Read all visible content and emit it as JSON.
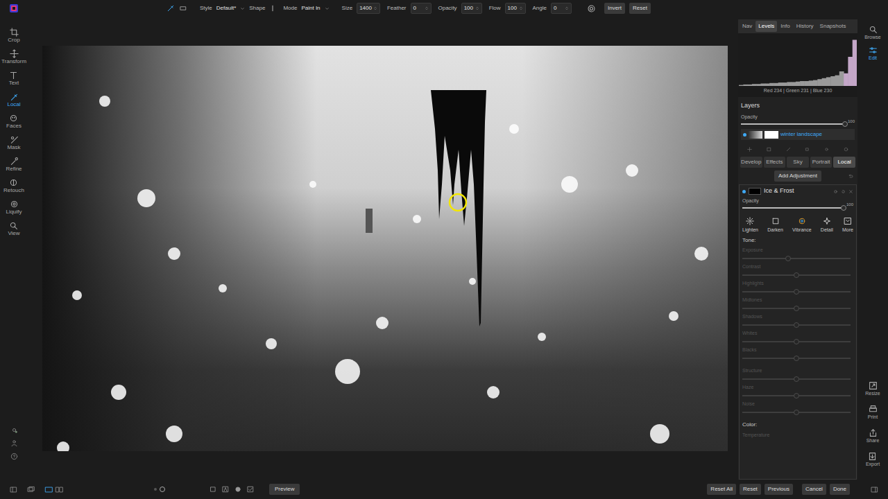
{
  "toolbar": {
    "style_label": "Style",
    "style_value": "Default*",
    "shape_label": "Shape",
    "mode_label": "Mode",
    "mode_value": "Paint In",
    "fields": [
      {
        "label": "Size",
        "value": "1400"
      },
      {
        "label": "Feather",
        "value": "0"
      },
      {
        "label": "Opacity",
        "value": "100"
      },
      {
        "label": "Flow",
        "value": "100"
      },
      {
        "label": "Angle",
        "value": "0"
      }
    ],
    "buttons": [
      "Invert",
      "Reset"
    ]
  },
  "tools": [
    {
      "label": "Crop",
      "selected": false
    },
    {
      "label": "Transform",
      "selected": false
    },
    {
      "label": "Text",
      "selected": false
    },
    {
      "label": "Local",
      "selected": true
    },
    {
      "label": "Faces",
      "selected": false
    },
    {
      "label": "Mask",
      "selected": false
    },
    {
      "label": "Refine",
      "selected": false
    },
    {
      "label": "Retouch",
      "selected": false
    },
    {
      "label": "Liquify",
      "selected": false
    },
    {
      "label": "View",
      "selected": false
    }
  ],
  "panel": {
    "tabs": [
      {
        "label": "Nav",
        "selected": false
      },
      {
        "label": "Levels",
        "selected": true
      },
      {
        "label": "Info",
        "selected": false
      },
      {
        "label": "History",
        "selected": false
      },
      {
        "label": "Snapshots",
        "selected": false
      }
    ],
    "histogram": [
      2,
      3,
      3,
      4,
      4,
      5,
      5,
      6,
      6,
      7,
      7,
      8,
      8,
      9,
      10,
      10,
      11,
      12,
      14,
      16,
      18,
      20,
      22,
      30,
      26,
      60,
      95
    ],
    "histogram_readout": "Red 234 | Green 231 | Blue 230",
    "layers": {
      "title": "Layers",
      "opacity_label": "Opacity",
      "opacity_value": "100",
      "opacity_level": 1,
      "layer_name": "winter landscape",
      "visible": true
    },
    "module_tabs": [
      {
        "label": "Develop",
        "selected": false
      },
      {
        "label": "Effects",
        "selected": false
      },
      {
        "label": "Sky",
        "selected": false
      },
      {
        "label": "Portrait",
        "selected": false
      },
      {
        "label": "Local",
        "selected": true
      }
    ],
    "add_adjustment": "Add Adjustment",
    "adjustment": {
      "name": "Ice & Frost",
      "visible": true,
      "opacity_label": "Opacity",
      "opacity_value": "100",
      "opacity_level": 1,
      "presets": [
        "Lighten",
        "Darken",
        "Vibrance",
        "Detail",
        "More"
      ],
      "tone_label": "Tone:",
      "sliders": [
        {
          "label": "Exposure",
          "level": 0.42,
          "disabled": true
        },
        {
          "label": "Contrast",
          "level": 0.5,
          "disabled": true
        },
        {
          "label": "Highlights",
          "level": 0.5,
          "disabled": true
        },
        {
          "label": "Midtones",
          "level": 0.5,
          "disabled": true
        },
        {
          "label": "Shadows",
          "level": 0.5,
          "disabled": true
        },
        {
          "label": "Whites",
          "level": 0.5,
          "disabled": true
        },
        {
          "label": "Blacks",
          "level": 0.5,
          "disabled": true
        },
        {
          "label": "Structure",
          "level": 0.5,
          "disabled": true
        },
        {
          "label": "Haze",
          "level": 0.5,
          "disabled": true
        },
        {
          "label": "Noise",
          "level": 0.5,
          "disabled": true
        }
      ],
      "color_label": "Color:",
      "color_sliders": [
        {
          "label": "Temperature",
          "disabled": true
        }
      ]
    }
  },
  "right_rail": {
    "top": [
      {
        "label": "Browse",
        "selected": false
      },
      {
        "label": "Edit",
        "selected": true
      }
    ],
    "bottom": [
      "Resize",
      "Print",
      "Share",
      "Export"
    ]
  },
  "bottom_bar": {
    "preview": "Preview",
    "buttons": [
      "Reset All",
      "Reset",
      "Previous",
      "Cancel",
      "Done"
    ]
  }
}
